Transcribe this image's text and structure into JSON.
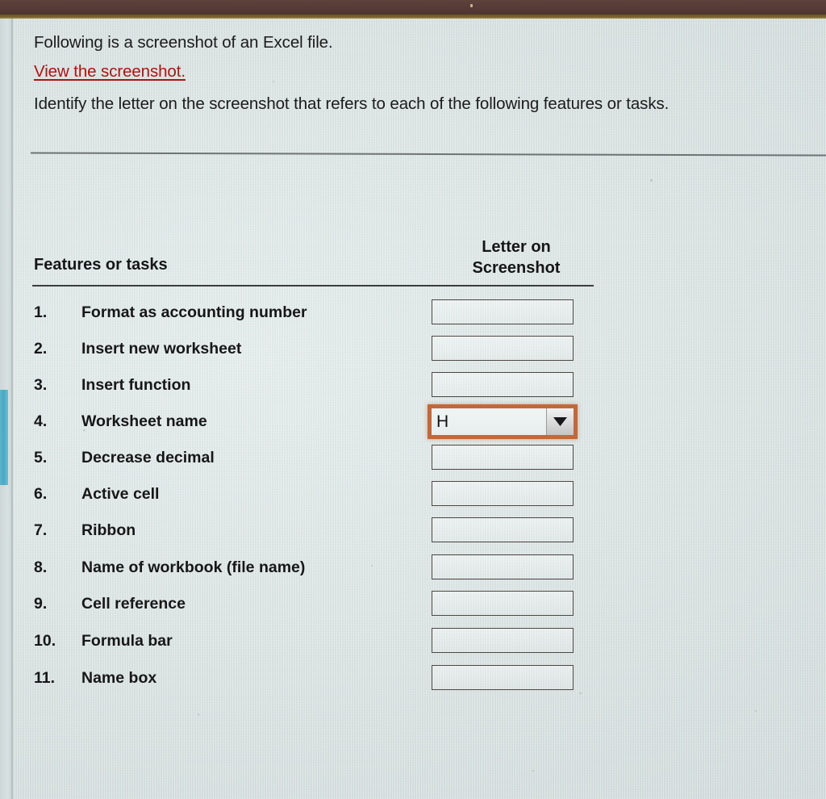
{
  "window": {
    "chrome_color": "#553a35",
    "accent_rule_color": "#7a6326"
  },
  "intro": {
    "line1": "Following is a screenshot of an Excel file.",
    "link_text": "View the screenshot.",
    "link_color": "#ac1512",
    "line3": "Identify the letter on the screenshot that refers to each of the following features or tasks."
  },
  "table": {
    "header_left": "Features or tasks",
    "header_right_line1": "Letter on",
    "header_right_line2": "Screenshot",
    "rows": [
      {
        "num": "1.",
        "label": "Format as accounting number",
        "value": "",
        "type": "textbox"
      },
      {
        "num": "2.",
        "label": "Insert new worksheet",
        "value": "",
        "type": "textbox"
      },
      {
        "num": "3.",
        "label": "Insert function",
        "value": "",
        "type": "textbox"
      },
      {
        "num": "4.",
        "label": "Worksheet name",
        "value": "H",
        "type": "dropdown"
      },
      {
        "num": "5.",
        "label": "Decrease decimal",
        "value": "",
        "type": "textbox"
      },
      {
        "num": "6.",
        "label": "Active cell",
        "value": "",
        "type": "textbox"
      },
      {
        "num": "7.",
        "label": "Ribbon",
        "value": "",
        "type": "textbox"
      },
      {
        "num": "8.",
        "label": "Name of workbook (file name)",
        "value": "",
        "type": "textbox"
      },
      {
        "num": "9.",
        "label": "Cell reference",
        "value": "",
        "type": "textbox"
      },
      {
        "num": "10.",
        "label": "Formula bar",
        "value": "",
        "type": "textbox"
      },
      {
        "num": "11.",
        "label": "Name box",
        "value": "",
        "type": "textbox"
      }
    ],
    "selected_row": 4,
    "selected_value": "H",
    "focus_ring_color": "#c3683a",
    "dropdown_icon": "chevron-down-icon"
  },
  "scrollbar": {
    "thumb_color": "#49a8c4",
    "orientation": "vertical"
  }
}
